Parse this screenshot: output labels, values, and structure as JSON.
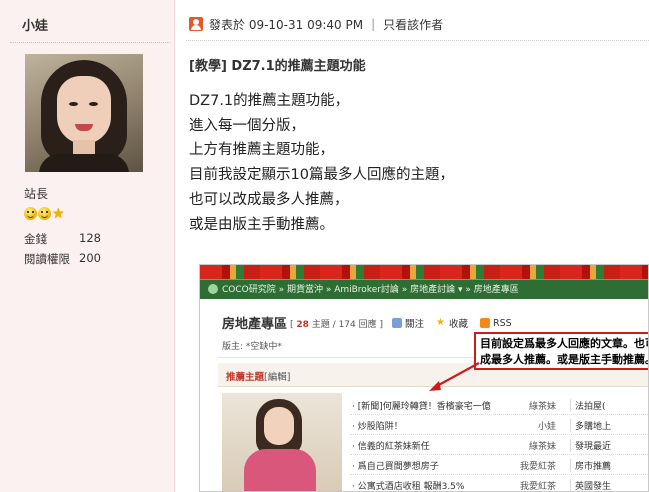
{
  "user": {
    "name": "小娃",
    "rank": "站長",
    "stats": [
      {
        "label": "金錢",
        "value": "128"
      },
      {
        "label": "閱讀權限",
        "value": "200"
      }
    ]
  },
  "post": {
    "meta_posted": "發表於 09-10-31 09:40 PM",
    "meta_author_only": "只看該作者",
    "title": "[教學] DZ7.1的推薦主題功能",
    "body_lines": [
      "DZ7.1的推薦主題功能，",
      "進入每一個分版，",
      "上方有推薦主題功能，",
      "目前我設定顯示10篇最多人回應的主題，",
      "也可以改成最多人推薦，",
      "或是由版主手動推薦。"
    ]
  },
  "embedded_screenshot": {
    "breadcrumb": "COCO研究院 » 期貨當沖 » AmiBroker討論 » 房地產討論 ▾ » 房地產專區",
    "forum_name": "房地產專區",
    "counts_prefix": "[",
    "counts_topics": "28",
    "counts_topics_label": "主題 /",
    "counts_replies": "174",
    "counts_replies_label": "回應 ]",
    "tools": [
      "關注",
      "收藏",
      "RSS"
    ],
    "moderator": "版主: *空缺中*",
    "recommend_title": "推薦主題",
    "recommend_edit": "[編輯]",
    "callout_line1": "目前設定爲最多人回應的文章。也可以",
    "callout_line2": "成最多人推薦。或是版主手動推薦。",
    "rows": [
      {
        "title": "· [新聞]何麗玲轉貸！香檳豪宅一億",
        "author": "綠茶妹",
        "extra": "法拍屋("
      },
      {
        "title": "· 炒股陷阱！",
        "author": "小娃",
        "extra": "多購地上"
      },
      {
        "title": "· 信義的紅茶妹新任",
        "author": "綠茶妹",
        "extra": "發現最近"
      },
      {
        "title": "· 爲自己買間夢想房子",
        "author": "我愛紅茶",
        "extra": "房市推薦"
      },
      {
        "title": "· 公寓式酒店收租 報酬3.5%",
        "author": "我愛紅茶",
        "extra": "英國發生"
      }
    ]
  },
  "colors": {
    "sidebar_bg": "#fcf1f1",
    "forum_green": "#2e6e34",
    "accent_red": "#d11a1a"
  }
}
